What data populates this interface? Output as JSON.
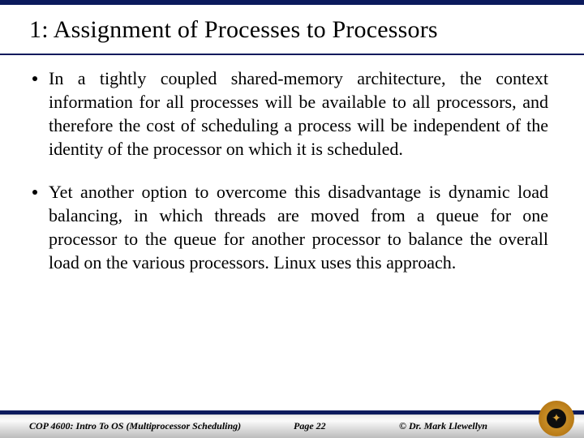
{
  "title": "1: Assignment of Processes to Processors",
  "bullets": [
    "In a tightly coupled shared-memory architecture, the context information for all processes will be available to all processors, and therefore the cost of scheduling a process will be independent of the identity of the processor on which it is scheduled.",
    "Yet another option to overcome this disadvantage is dynamic load balancing, in which threads are moved from a queue for one processor to the queue for another processor to balance the overall load on the various processors.  Linux uses this approach."
  ],
  "footer": {
    "course": "COP 4600: Intro To OS  (Multiprocessor Scheduling)",
    "page": "Page 22",
    "author": "© Dr. Mark Llewellyn"
  },
  "logo_glyph": "✦"
}
